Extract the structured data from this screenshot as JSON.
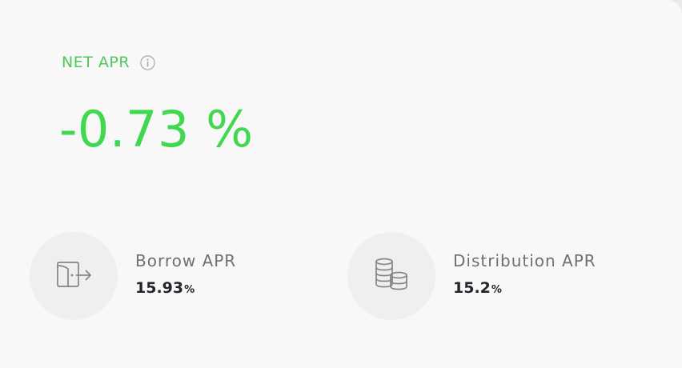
{
  "net_apr": {
    "label": "NET APR",
    "value": "-0.73 %",
    "info_icon": "info-circle-icon",
    "color": "#3fd84f"
  },
  "stats": {
    "borrow": {
      "icon": "wallet-export-icon",
      "label": "Borrow APR",
      "value": "15.93",
      "unit": "%"
    },
    "distribution": {
      "icon": "coins-stack-icon",
      "label": "Distribution APR",
      "value": "15.2",
      "unit": "%"
    }
  }
}
